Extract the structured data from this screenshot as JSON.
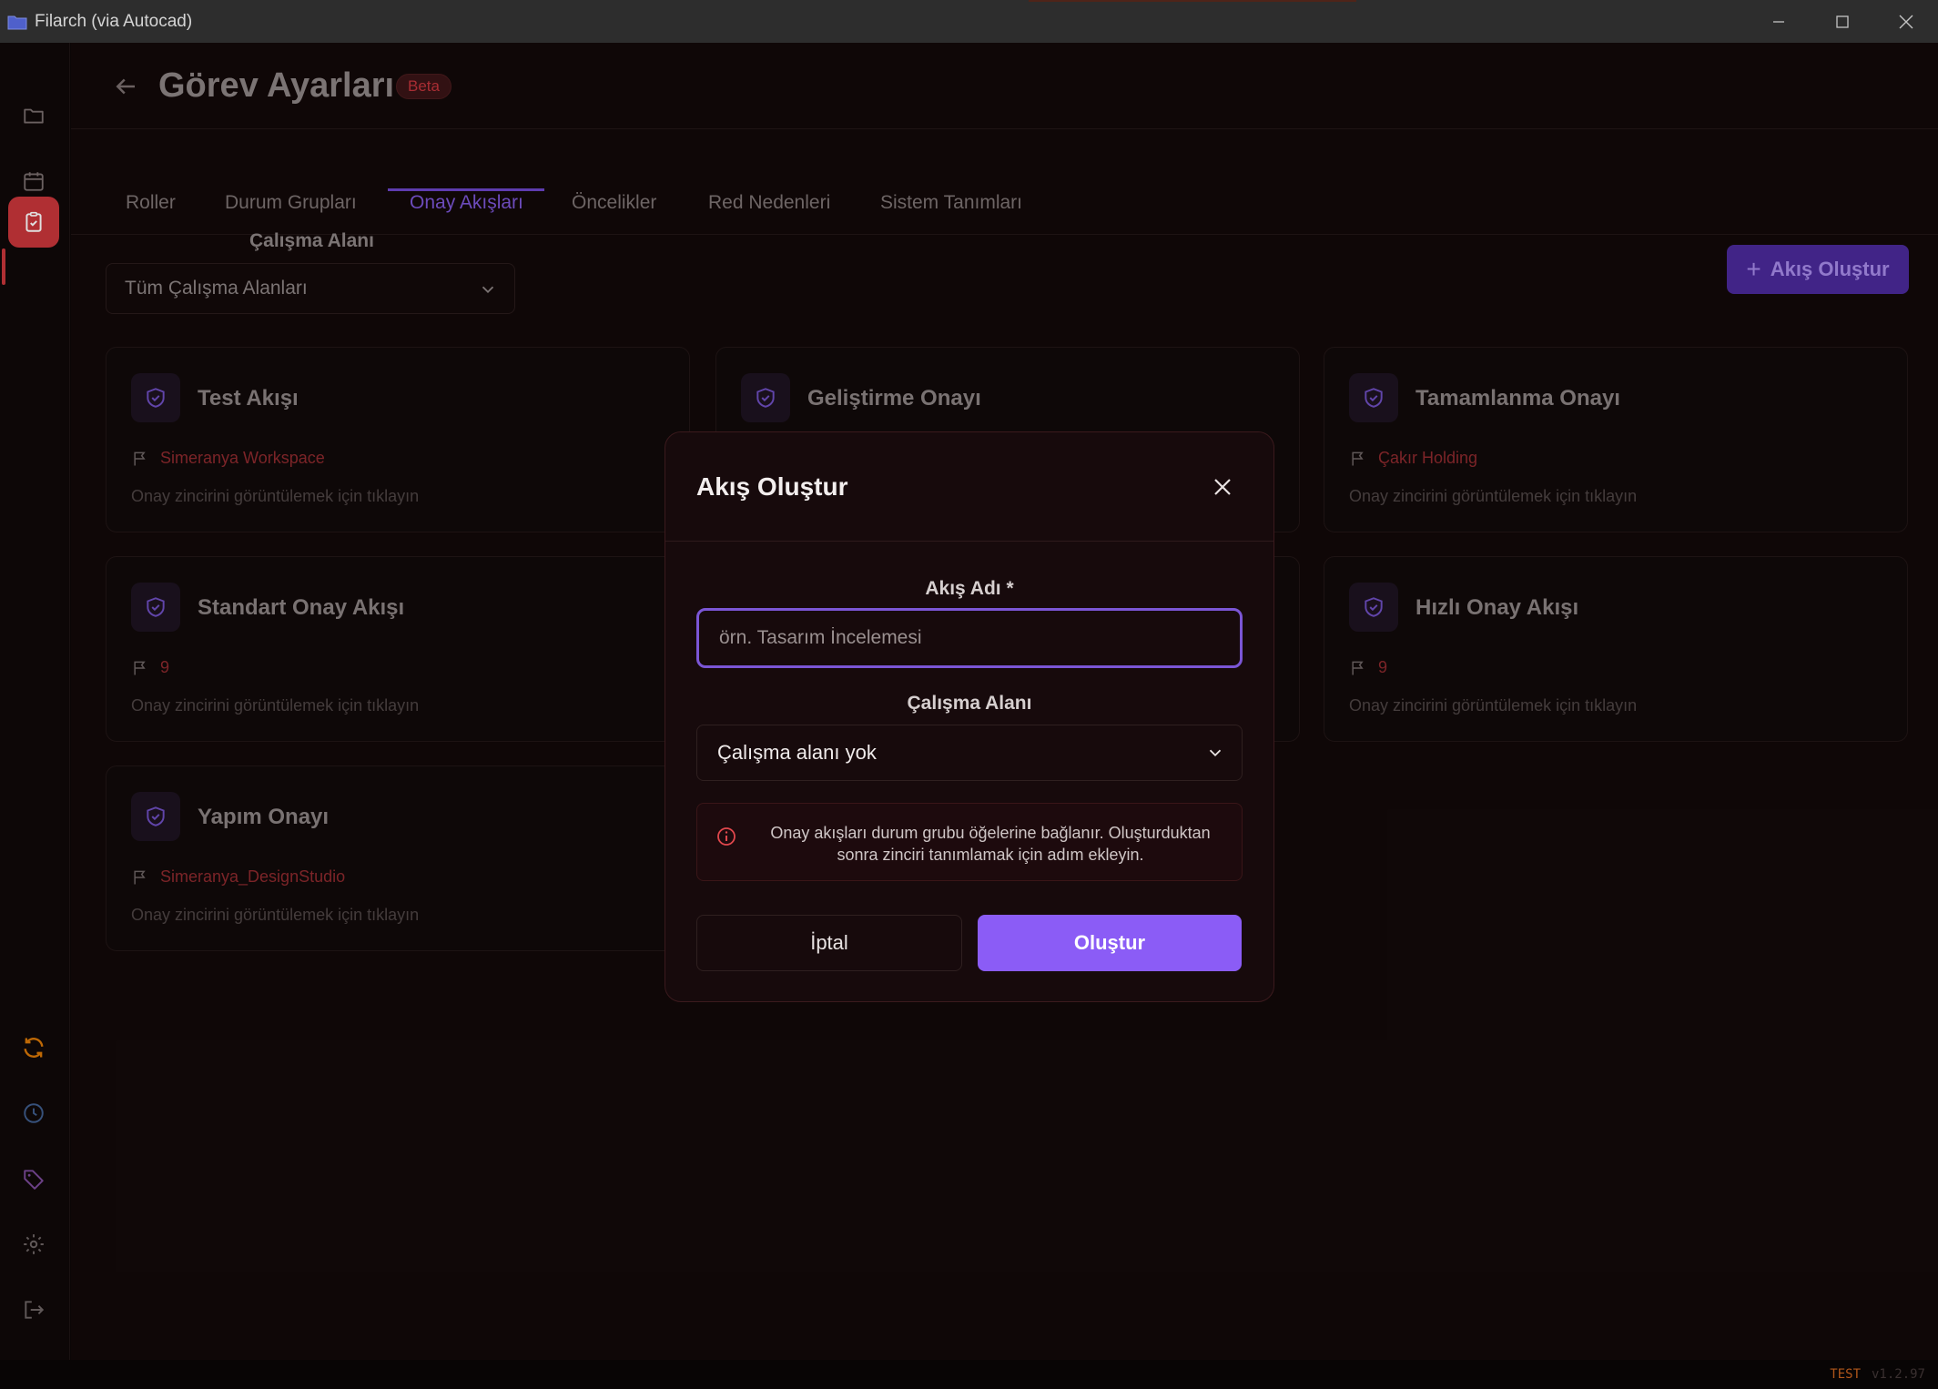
{
  "window": {
    "title": "Filarch (via Autocad)"
  },
  "page": {
    "title": "Görev Ayarları",
    "badge": "Beta"
  },
  "tabs": [
    {
      "label": "Roller"
    },
    {
      "label": "Durum Grupları"
    },
    {
      "label": "Onay Akışları",
      "active": true
    },
    {
      "label": "Öncelikler"
    },
    {
      "label": "Red Nedenleri"
    },
    {
      "label": "Sistem Tanımları"
    }
  ],
  "filter": {
    "label": "Çalışma Alanı",
    "selected": "Tüm Çalışma Alanları"
  },
  "actions": {
    "create_flow": "Akış Oluştur"
  },
  "cards": [
    {
      "name": "Test Akışı",
      "workspace": "Simeranya Workspace",
      "hint": "Onay zincirini görüntülemek için tıklayın"
    },
    {
      "name": "Geliştirme Onayı",
      "workspace": "",
      "hint": ""
    },
    {
      "name": "Tamamlanma Onayı",
      "workspace": "Çakır Holding",
      "hint": "Onay zincirini görüntülemek için tıklayın"
    },
    {
      "name": "Standart Onay Akışı",
      "workspace": "9",
      "hint": "Onay zincirini görüntülemek için tıklayın"
    },
    {
      "name": "Hızlı Onay Akışı",
      "workspace": "9",
      "hint": "Onay zincirini görüntülemek için tıklayın"
    },
    {
      "name": "Yapım Onayı",
      "workspace": "Simeranya_DesignStudio",
      "hint": "Onay zincirini görüntülemek için tıklayın"
    }
  ],
  "modal": {
    "title": "Akış Oluştur",
    "name_label": "Akış Adı *",
    "name_placeholder": "örn. Tasarım İncelemesi",
    "name_value": "",
    "workspace_label": "Çalışma Alanı",
    "workspace_selected": "Çalışma alanı yok",
    "info": "Onay akışları durum grubu öğelerine bağlanır. Oluşturduktan sonra zinciri tanımlamak için adım ekleyin.",
    "cancel": "İptal",
    "submit": "Oluştur"
  },
  "footer": {
    "env": "TEST",
    "version": "v1.2.97"
  },
  "colors": {
    "accent": "#8b5cf6",
    "danger": "#c9363b",
    "sync": "#d97706"
  },
  "sidebar_icons": [
    "folder-icon",
    "calendar-icon",
    "clipboard-check-icon",
    "sync-icon",
    "clock-icon",
    "tag-icon",
    "gear-icon",
    "logout-icon"
  ]
}
